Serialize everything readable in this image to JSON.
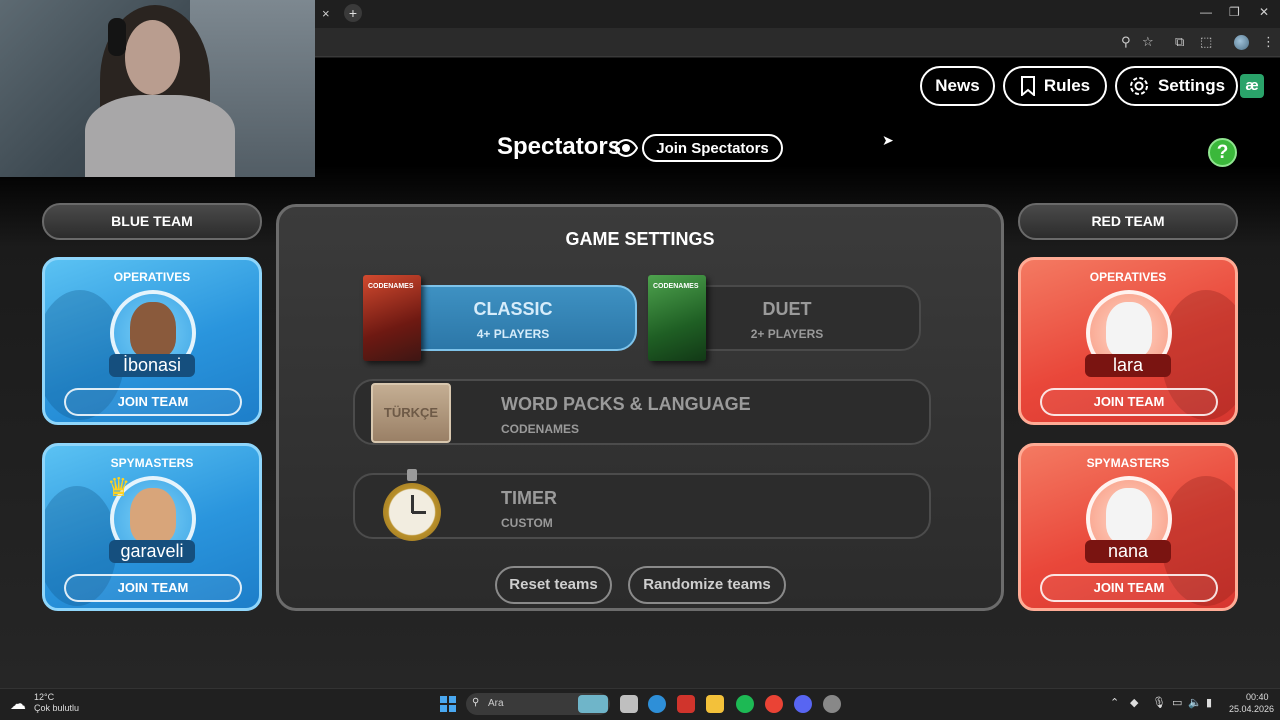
{
  "browser": {
    "close_tab_glyph": "×",
    "new_tab_glyph": "+",
    "window_controls": [
      "—",
      "❐",
      "✕"
    ],
    "toolbar_icons": [
      "zoom-icon",
      "star-icon",
      "extension-icon",
      "puzzle-icon",
      "profile-icon",
      "kebab-menu-icon"
    ]
  },
  "header": {
    "news_label": "News",
    "rules_label": "Rules",
    "settings_label": "Settings",
    "ae_badge": "æ"
  },
  "spectators": {
    "title": "Spectators",
    "join_label": "Join Spectators"
  },
  "help": {
    "label": "?"
  },
  "blue_team": {
    "header": "BLUE TEAM",
    "operatives": {
      "role": "OPERATIVES",
      "player": "İbonasi",
      "join_label": "JOIN TEAM"
    },
    "spymasters": {
      "role": "SPYMASTERS",
      "player": "garaveli",
      "join_label": "JOIN TEAM"
    }
  },
  "red_team": {
    "header": "RED TEAM",
    "operatives": {
      "role": "OPERATIVES",
      "player": "lara",
      "join_label": "JOIN TEAM"
    },
    "spymasters": {
      "role": "SPYMASTERS",
      "player": "nana",
      "join_label": "JOIN TEAM"
    }
  },
  "game_settings": {
    "title": "GAME SETTINGS",
    "modes": [
      {
        "name": "CLASSIC",
        "players": "4+ PLAYERS",
        "box_label": "CODENAMES",
        "selected": true
      },
      {
        "name": "DUET",
        "players": "2+ PLAYERS",
        "box_label": "CODENAMES",
        "selected": false
      }
    ],
    "word_packs": {
      "title": "WORD PACKS & LANGUAGE",
      "sub": "CODENAMES",
      "language_card": "TÜRKÇE"
    },
    "timer": {
      "title": "TIMER",
      "sub": "CUSTOM"
    },
    "reset_label": "Reset teams",
    "randomize_label": "Randomize teams"
  },
  "taskbar": {
    "weather_temp": "12°C",
    "weather_desc": "Çok bulutlu",
    "search_placeholder": "Ara",
    "time": "00:40",
    "date": "25.04.2026"
  },
  "colors": {
    "blue_team": "#2a95dd",
    "red_team": "#e9473a",
    "help_green": "#3bb83b",
    "classic_selected": "#3e91c2"
  }
}
